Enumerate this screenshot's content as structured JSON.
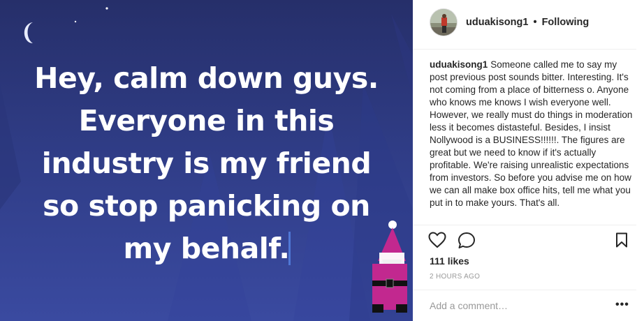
{
  "post": {
    "quote_lines": [
      "Hey, calm down guys.",
      "Everyone in this",
      "industry is my friend",
      "so stop panicking on",
      "my behalf."
    ]
  },
  "header": {
    "username": "uduakisong1",
    "separator": "•",
    "follow_status": "Following"
  },
  "caption": {
    "username": "uduakisong1",
    "text": "Someone called me to say my post previous post sounds bitter. Interesting. It's not coming from a place of bitterness o. Anyone who knows me knows I wish everyone well. However, we really must do things in moderation less it becomes distasteful. Besides, I insist Nollywood is a BUSINESS!!!!!!. The figures are great but we need to know if it's actually profitable. We're raising unrealistic expectations from investors. So before you advise me on how we can all make box office hits, tell me what you put in to make yours. That's all."
  },
  "engagement": {
    "likes": "111 likes",
    "timestamp": "2 HOURS AGO"
  },
  "comment": {
    "placeholder": "Add a comment…",
    "more_label": "•••"
  },
  "icons": {
    "like": "heart-icon",
    "comment": "comment-bubble-icon",
    "save": "bookmark-icon",
    "moon": "moon-icon"
  },
  "colors": {
    "image_bg_top": "#262f6a",
    "image_bg_bottom": "#3a4aa0",
    "gnome_hat": "#c2288f",
    "text_primary": "#262626",
    "text_secondary": "#999999"
  }
}
